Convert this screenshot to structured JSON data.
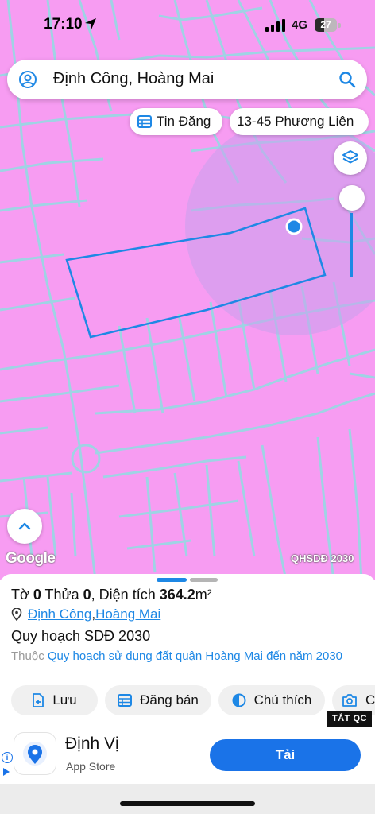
{
  "status_bar": {
    "time": "17:10",
    "network": "4G",
    "battery": "27"
  },
  "search": {
    "query": "Định Công, Hoàng Mai",
    "left_icon": "account-circle-icon",
    "right_icon": "search-icon"
  },
  "chips": {
    "listings": "Tin Đăng",
    "location": "13-45 Phương Liên"
  },
  "map": {
    "background_color": "#f79cf2",
    "road_color": "#9fd3e4",
    "parcel_outline_color": "#1e88e5",
    "watermark": "Google",
    "layer_tag": "QHSDĐ 2030",
    "opacity_level": 0.6
  },
  "parcel": {
    "sheet_label": "Tờ",
    "sheet_value": "0",
    "lot_label": "Thửa",
    "lot_value": "0",
    "area_label": "Diện tích",
    "area_value": "364.2",
    "area_unit": "m²",
    "ward": "Định Công",
    "district": "Hoàng Mai",
    "separator": ", "
  },
  "plan": {
    "title": "Quy hoạch SDĐ 2030",
    "belongs_prefix": "Thuộc",
    "link_text": "Quy hoạch sử dụng đất quận Hoàng Mai đến năm 2030"
  },
  "actions": [
    {
      "label": "Lưu",
      "icon": "save-plus-icon"
    },
    {
      "label": "Đăng bán",
      "icon": "listing-icon"
    },
    {
      "label": "Chú thích",
      "icon": "contrast-icon"
    },
    {
      "label": "C",
      "icon": "camera-icon"
    }
  ],
  "ad": {
    "close_label": "TẮT QC",
    "app_name": "Định Vị",
    "store": "App Store",
    "cta": "Tải",
    "accent": "#1a73e8"
  }
}
